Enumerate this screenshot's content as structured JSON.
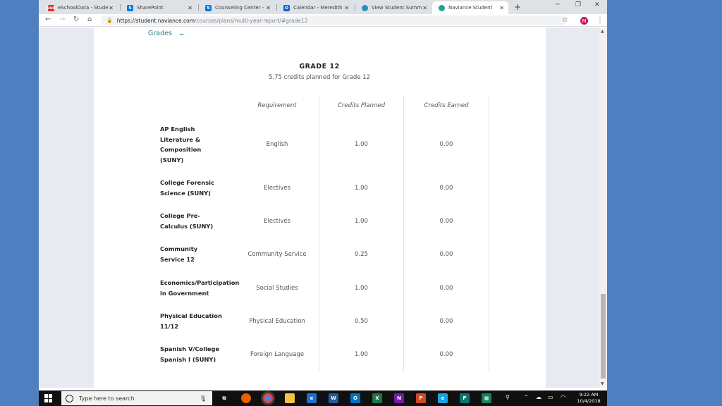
{
  "browser": {
    "tabs": [
      {
        "label": "eSchoolData - Stude",
        "icon": "esd-icon",
        "icon_text": "esd",
        "color": "#d93025"
      },
      {
        "label": "SharePoint",
        "icon": "sharepoint-icon",
        "icon_text": "S",
        "color": "#0f78d4"
      },
      {
        "label": "Counseling Center -",
        "icon": "sharepoint-icon",
        "icon_text": "S",
        "color": "#0f78d4"
      },
      {
        "label": "Calendar - Meredith",
        "icon": "outlook-icon",
        "icon_text": "O",
        "color": "#0a64c2"
      },
      {
        "label": "View Student Summ",
        "icon": "globe-icon",
        "icon_text": "",
        "color": "#2a8fbd"
      },
      {
        "label": "Naviance Student",
        "icon": "naviance-icon",
        "icon_text": "",
        "color": "#1aa59a"
      }
    ],
    "active_tab": 5,
    "url_host": "https://student.naviance.com",
    "url_path": "/courses/plans/multi-year-report/#grade12",
    "profile_initial": "M"
  },
  "page": {
    "grades_link": "Grades",
    "grade_title": "GRADE 12",
    "grade_subtitle": "5.75 credits planned for Grade 12",
    "columns": {
      "requirement": "Requirement",
      "credits_planned": "Credits Planned",
      "credits_earned": "Credits Earned"
    },
    "courses": [
      {
        "name_lines": [
          "AP English",
          "Literature &",
          "Composition",
          "(SUNY)"
        ],
        "requirement": "English",
        "planned": "1.00",
        "earned": "0.00"
      },
      {
        "name_lines": [
          "College Forensic",
          "Science (SUNY)"
        ],
        "requirement": "Electives",
        "planned": "1.00",
        "earned": "0.00"
      },
      {
        "name_lines": [
          "College Pre-",
          "Calculus (SUNY)"
        ],
        "requirement": "Electives",
        "planned": "1.00",
        "earned": "0.00"
      },
      {
        "name_lines": [
          "Community",
          "Service 12"
        ],
        "requirement": "Community Service",
        "planned": "0.25",
        "earned": "0.00"
      },
      {
        "name_lines": [
          "Economics/Participation",
          "in Government"
        ],
        "requirement": "Social Studies",
        "planned": "1.00",
        "earned": "0.00"
      },
      {
        "name_lines": [
          "Physical Education",
          "11/12"
        ],
        "requirement": "Physical Education",
        "planned": "0.50",
        "earned": "0.00"
      },
      {
        "name_lines": [
          "Spanish V/College",
          "Spanish I (SUNY)"
        ],
        "requirement": "Foreign Language",
        "planned": "1.00",
        "earned": "0.00"
      }
    ]
  },
  "taskbar": {
    "search_placeholder": "Type here to search",
    "time": "9:22 AM",
    "date": "10/4/2018",
    "apps": [
      {
        "name": "task-view-icon",
        "text": "⧉",
        "color": "#101010"
      },
      {
        "name": "firefox-icon",
        "text": "",
        "color": "#e66000"
      },
      {
        "name": "chrome-icon",
        "text": "",
        "color": "#4285f4"
      },
      {
        "name": "file-explorer-icon",
        "text": "",
        "color": "#f3c343"
      },
      {
        "name": "edge-icon",
        "text": "e",
        "color": "#1f6fd1"
      },
      {
        "name": "word-icon",
        "text": "W",
        "color": "#2b579a"
      },
      {
        "name": "outlook-icon",
        "text": "O",
        "color": "#0072c6"
      },
      {
        "name": "excel-icon",
        "text": "X",
        "color": "#217346"
      },
      {
        "name": "onenote-icon",
        "text": "N",
        "color": "#7719aa"
      },
      {
        "name": "powerpoint-icon",
        "text": "P",
        "color": "#d24726"
      },
      {
        "name": "ie-icon",
        "text": "e",
        "color": "#1ba1e2"
      },
      {
        "name": "publisher-icon",
        "text": "P",
        "color": "#077568"
      },
      {
        "name": "teams-icon",
        "text": "▦",
        "color": "#1a7f5a"
      }
    ]
  },
  "colors": {
    "desktop": "#4f7fc0",
    "accent": "#168489"
  }
}
